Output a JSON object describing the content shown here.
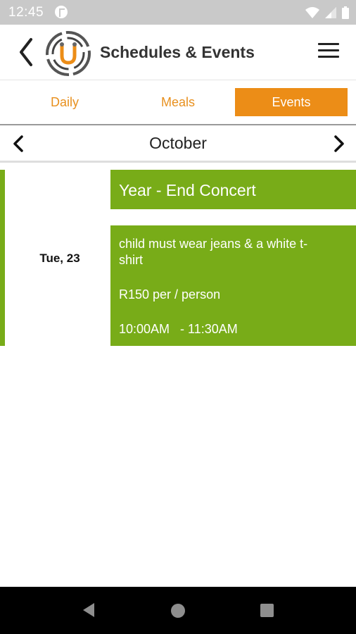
{
  "status_bar": {
    "time": "12:45",
    "icons": [
      "notification-icon",
      "wifi-icon",
      "signal-icon",
      "battery-icon"
    ]
  },
  "app_bar": {
    "title": "Schedules & Events",
    "back_icon": "chevron-left-icon",
    "menu_icon": "hamburger-menu-icon"
  },
  "tabs": [
    {
      "label": "Daily",
      "active": false
    },
    {
      "label": "Meals",
      "active": false
    },
    {
      "label": "Events",
      "active": true
    }
  ],
  "month_nav": {
    "month": "October",
    "prev_icon": "chevron-left-icon",
    "next_icon": "chevron-right-icon"
  },
  "events": [
    {
      "date": "Tue, 23",
      "title": "Year - End Concert",
      "description": "child must wear jeans & a white t-shirt",
      "price": "R150 per / person",
      "time": "10:00AM   - 11:30AM"
    }
  ],
  "colors": {
    "accent": "#ec8d17",
    "event_green": "#78ac18",
    "status_bar": "#c9c9c9",
    "nav_bar": "#000000"
  }
}
